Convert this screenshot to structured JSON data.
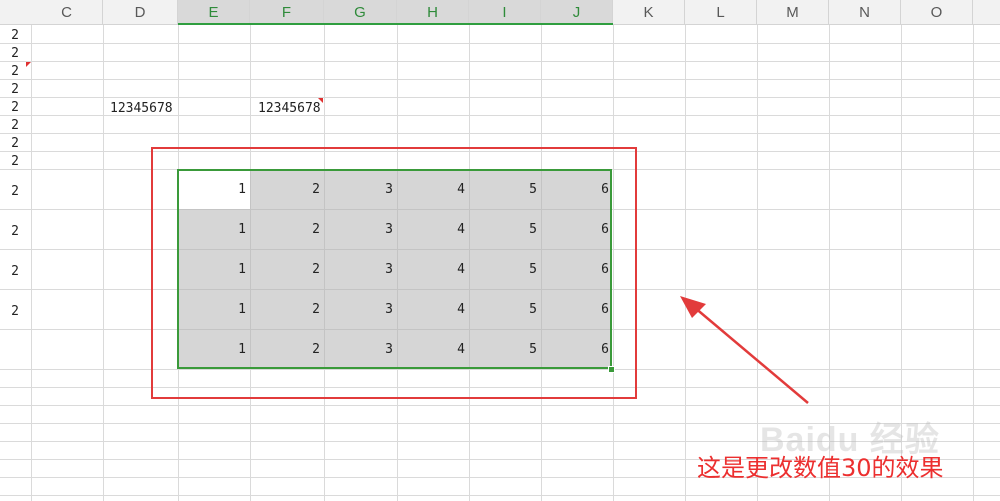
{
  "columns": [
    {
      "label": "C",
      "selected": false
    },
    {
      "label": "D",
      "selected": false
    },
    {
      "label": "E",
      "selected": true
    },
    {
      "label": "F",
      "selected": true
    },
    {
      "label": "G",
      "selected": true
    },
    {
      "label": "H",
      "selected": true
    },
    {
      "label": "I",
      "selected": true
    },
    {
      "label": "J",
      "selected": true
    },
    {
      "label": "K",
      "selected": false
    },
    {
      "label": "L",
      "selected": false
    },
    {
      "label": "M",
      "selected": false
    },
    {
      "label": "N",
      "selected": false
    },
    {
      "label": "O",
      "selected": false
    }
  ],
  "row_numbers": [
    "2",
    "2",
    "2",
    "2",
    "2",
    "2",
    "2",
    "2",
    "2",
    "2",
    "2",
    "2"
  ],
  "cells": {
    "d_value": "12345678",
    "f_value": "12345678"
  },
  "selection_data": [
    [
      "1",
      "2",
      "3",
      "4",
      "5",
      "6"
    ],
    [
      "1",
      "2",
      "3",
      "4",
      "5",
      "6"
    ],
    [
      "1",
      "2",
      "3",
      "4",
      "5",
      "6"
    ],
    [
      "1",
      "2",
      "3",
      "4",
      "5",
      "6"
    ],
    [
      "1",
      "2",
      "3",
      "4",
      "5",
      "6"
    ]
  ],
  "annotation": {
    "caption": "这是更改数值30的效果",
    "color": "#ec2f2f"
  },
  "watermark": "Baidu 经验",
  "colors": {
    "selection_border": "#3a9a3a",
    "selection_fill": "#d6d6d6",
    "annotation_box": "#e23b3b"
  }
}
